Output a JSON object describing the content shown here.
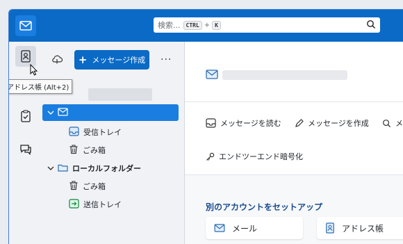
{
  "search": {
    "placeholder": "検索...",
    "key1": "CTRL",
    "plus": "+",
    "key2": "K"
  },
  "folder_pane": {
    "compose_label": "メッセージ作成",
    "compose_plus": "+",
    "more_label": "···",
    "folders": [
      {
        "label": "",
        "icon": "mail-account-icon",
        "selected": true,
        "bold": false
      },
      {
        "label": "受信トレイ",
        "icon": "inbox-icon"
      },
      {
        "label": "ごみ箱",
        "icon": "trash-icon"
      },
      {
        "label": "ローカルフォルダー",
        "icon": "folder-icon",
        "bold": true
      },
      {
        "label": "ごみ箱",
        "icon": "trash-icon"
      },
      {
        "label": "送信トレイ",
        "icon": "outbox-icon"
      }
    ]
  },
  "tooltip": {
    "text": "アドレス帳 (Alt+2)"
  },
  "main": {
    "actions": {
      "read": "メッセージを読む",
      "compose": "メッセージを作成",
      "search_partial": "メ",
      "e2e": "エンドツーエンド暗号化"
    },
    "setup_title": "別のアカウントをセットアップ",
    "cards": {
      "mail": "メール",
      "addressbook": "アドレス帳"
    }
  },
  "colors": {
    "accent": "#0a6ac6",
    "selected": "#1a7de0",
    "setup_title": "#1a4b8f"
  }
}
